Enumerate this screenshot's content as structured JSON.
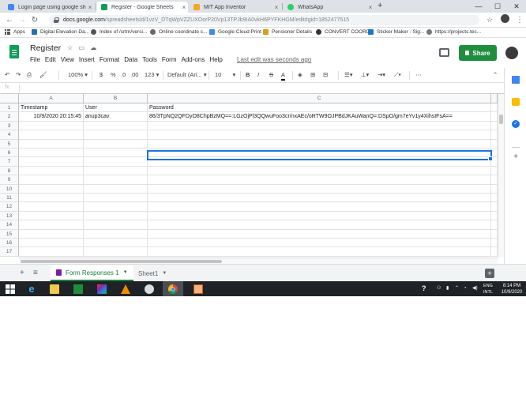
{
  "browser": {
    "tabs": [
      {
        "title": "Login page using google sheets",
        "active": false
      },
      {
        "title": "Register - Google Sheets",
        "active": true
      },
      {
        "title": "MIT App Inventor",
        "active": false
      },
      {
        "title": "WhatsApp",
        "active": false
      }
    ],
    "new_tab": "+",
    "window_controls": {
      "minimize": "—",
      "maximize": "☐",
      "close": "✕"
    },
    "url_domain": "docs.google.com",
    "url_path": "/spreadsheets/d/1vzV_DTqWpVZZUXOorP20Vp13TPJb9IA0vkH6PYFKHGM/edit#gid=1852477515",
    "bookmarks": [
      "Apps",
      "Digital Elevation Da...",
      "Index of /srtm/versi...",
      "Online coordinate c...",
      "Google Cloud Print",
      "Pensioner Details",
      "CONVERT COORD",
      "Sticker Maker - Sig...",
      "https://projects.tec..."
    ]
  },
  "doc": {
    "title": "Register",
    "menu": [
      "File",
      "Edit",
      "View",
      "Insert",
      "Format",
      "Data",
      "Tools",
      "Form",
      "Add-ons",
      "Help"
    ],
    "last_edit": "Last edit was seconds ago",
    "share_label": "Share"
  },
  "toolbar": {
    "zoom": "100%",
    "currency": "$",
    "percent": "%",
    "dec_decrease": ".0",
    "dec_increase": ".00",
    "more_formats": "123",
    "font": "Default (Ari...",
    "font_size": "10",
    "bold": "B",
    "italic": "I",
    "strike": "S",
    "text_color": "A",
    "more": "⋯"
  },
  "formula_bar": {
    "fx": "fx",
    "value": ""
  },
  "sheet": {
    "columns": [
      "A",
      "B",
      "C"
    ],
    "row_numbers": [
      "1",
      "2",
      "3",
      "4",
      "5",
      "6",
      "7",
      "8",
      "9",
      "10",
      "11",
      "12",
      "13",
      "14",
      "15",
      "16",
      "17"
    ],
    "header_row": [
      "Timestamp",
      "User",
      "Password"
    ],
    "data_row": [
      "10/9/2020 20:15:45",
      "anup3cav",
      "86/3TpNQ2QFDyO8ChpBzMQ==:LGzOjPl3QQwuFoo3cr/nxAEc/oRTW9OJPBdJKAuWanQ=:DSpO/gm7eYv1y4XihsIFsA=="
    ]
  },
  "sheet_tabs": {
    "add": "+",
    "all_sheets": "≡",
    "tabs": [
      {
        "name": "Form Responses 1",
        "active": true
      },
      {
        "name": "Sheet1",
        "active": false
      }
    ]
  },
  "taskbar": {
    "time": "8:14 PM",
    "date": "10/9/2020",
    "lang_line1": "ENG",
    "lang_line2": "INTL",
    "help": "?"
  },
  "colors": {
    "sheets_green": "#0f9d58",
    "share_green": "#1e8e3e",
    "selection_blue": "#1a73e8",
    "form_purple": "#7b1fa2"
  }
}
